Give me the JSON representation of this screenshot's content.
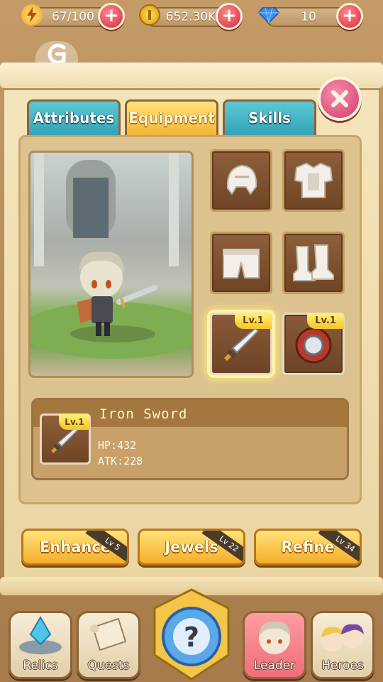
{
  "resources": {
    "energy": "67/100",
    "gold": "652.30K",
    "gems": "10"
  },
  "tabs": [
    {
      "label": "Attributes"
    },
    {
      "label": "Equipment"
    },
    {
      "label": "Skills"
    }
  ],
  "active_tab": "Equipment",
  "equipment_slots": [
    {
      "slot": "helmet",
      "equipped": false
    },
    {
      "slot": "armor",
      "equipped": false
    },
    {
      "slot": "pants",
      "equipped": false
    },
    {
      "slot": "boots",
      "equipped": false
    },
    {
      "slot": "weapon",
      "equipped": true,
      "level": "Lv.1",
      "selected": true
    },
    {
      "slot": "shield",
      "equipped": true,
      "level": "Lv.1",
      "selected": false
    }
  ],
  "item": {
    "name": "Iron Sword",
    "level": "Lv.1",
    "hp": "HP:432",
    "atk": "ATK:228"
  },
  "actions": [
    {
      "label": "Enhance",
      "lock": "Lv 5"
    },
    {
      "label": "Jewels",
      "lock": "Lv 22"
    },
    {
      "label": "Refine",
      "lock": "Lv 34"
    }
  ],
  "nav": [
    {
      "label": "Relics"
    },
    {
      "label": "Quests"
    },
    {
      "label": "Leader"
    },
    {
      "label": "Heroes"
    }
  ],
  "colors": {
    "active_tab": "#f4b636",
    "inactive_tab": "#32a4b8",
    "close_button": "#d43a6b",
    "plus_button": "#d8283a",
    "action_button": "#f4ae2a"
  }
}
